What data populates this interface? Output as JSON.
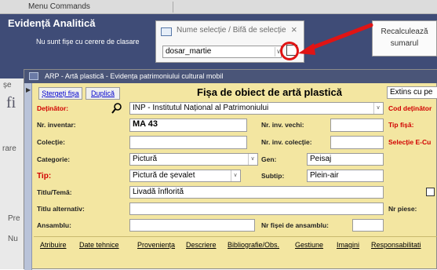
{
  "background": {
    "menu_label": "Menu Commands",
    "title": "Evidență Analitică",
    "subtitle": "Nu sunt fișe cu cerere de clasare",
    "left_strip": [
      "șe",
      "fi",
      "rare",
      "Pre",
      "Nu"
    ]
  },
  "popup": {
    "title": "Nume selecție / Bifă de selecție",
    "close": "×",
    "select_value": "dosar_martie",
    "arrow": "∨"
  },
  "recalc_button": {
    "line1": "Recalculează",
    "line2": "sumarul"
  },
  "form": {
    "window_title": "ARP - Artă plastică - Evidența patrimoniului cultural mobil",
    "nav_arrow": "▶",
    "heading": "Fișa de obiect de artă plastică",
    "buttons": {
      "delete": "Ștergeți fișa",
      "duplicate": "Duplică"
    },
    "extins": "Extins cu pe",
    "detinator": {
      "label": "Deținător:",
      "value": "INP - Institutul Național al Patrimoniului",
      "right_label": "Cod deținător"
    },
    "row_inv": {
      "label": "Nr. inventar:",
      "value": "MA 43",
      "old_label": "Nr. inv. vechi:",
      "old_value": "",
      "right_label": "Tip fișă:"
    },
    "row_col": {
      "label": "Colecție:",
      "value": "",
      "inv_col_label": "Nr. inv. colecție:",
      "inv_col_value": "",
      "right_label": "Selecție E-Cu"
    },
    "row_cat": {
      "label": "Categorie:",
      "value": "Pictură",
      "gen_label": "Gen:",
      "gen_value": "Peisaj"
    },
    "row_tip": {
      "label": "Tip:",
      "value": "Pictură de șevalet",
      "subtip_label": "Subtip:",
      "subtip_value": "Plein-air"
    },
    "row_titlu": {
      "label": "Titlu/Temă:",
      "value": "Livadă înflorită"
    },
    "row_alt": {
      "label": "Titlu alternativ:",
      "value": "",
      "right_label": "Nr piese:"
    },
    "row_ans": {
      "label": "Ansamblu:",
      "value": "",
      "nr_label": "Nr fișei de ansamblu:",
      "nr_value": ""
    },
    "tabs": [
      "Atribuire",
      "Date tehnice",
      "Proveniența",
      "Descriere",
      "Bibliografie/Obs.",
      "Gestiune",
      "Imagini",
      "Responsabilitati"
    ]
  },
  "colors": {
    "form_bg": "#f3e6a1",
    "header_bg": "#3f4c77",
    "highlight_red": "#e01414",
    "label_red": "#d10000"
  },
  "icons": [
    "window-icon",
    "close-icon",
    "dropdown-arrow-icon",
    "search-icon",
    "checkbox-icon",
    "red-arrow-annotation",
    "red-circle-annotation"
  ]
}
